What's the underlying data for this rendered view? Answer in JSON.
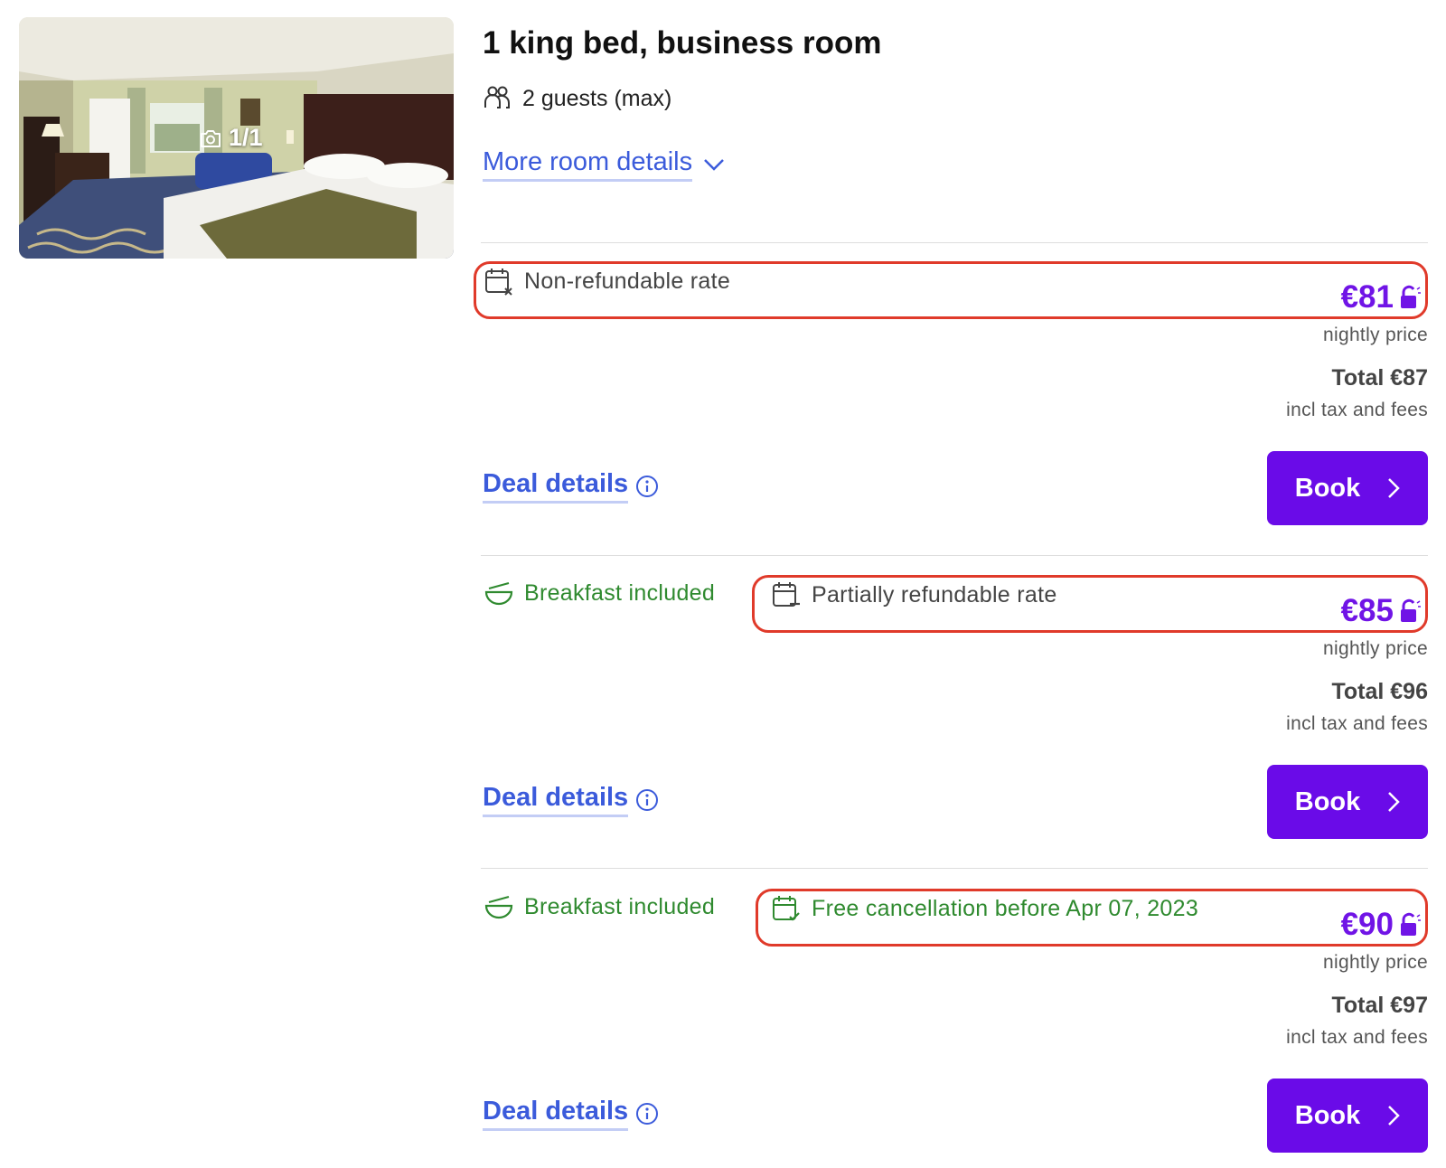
{
  "photo": {
    "counter": "1/1"
  },
  "room": {
    "title": "1 king bed, business room",
    "guests": "2 guests (max)",
    "more_details": "More room details"
  },
  "colors": {
    "price_purple": "#7014e6",
    "book_button": "#6a0be8",
    "link_blue": "#3b5bdb",
    "feature_green": "#2f8a2f",
    "highlight_red": "#e03a2a"
  },
  "offers": [
    {
      "rate": "Non-refundable rate",
      "rate_icon": "calendar-x-icon",
      "price": "€81",
      "nightly": "nightly price",
      "total": "Total €87",
      "incl": "incl tax and fees",
      "deal": "Deal details",
      "book": "Book"
    },
    {
      "breakfast": "Breakfast included",
      "rate": "Partially refundable rate",
      "rate_icon": "calendar-minus-icon",
      "price": "€85",
      "nightly": "nightly price",
      "total": "Total €96",
      "incl": "incl tax and fees",
      "deal": "Deal details",
      "book": "Book"
    },
    {
      "breakfast": "Breakfast included",
      "rate": "Free cancellation before Apr 07, 2023",
      "rate_icon": "calendar-check-icon",
      "price": "€90",
      "nightly": "nightly price",
      "total": "Total €97",
      "incl": "incl tax and fees",
      "deal": "Deal details",
      "book": "Book"
    }
  ]
}
